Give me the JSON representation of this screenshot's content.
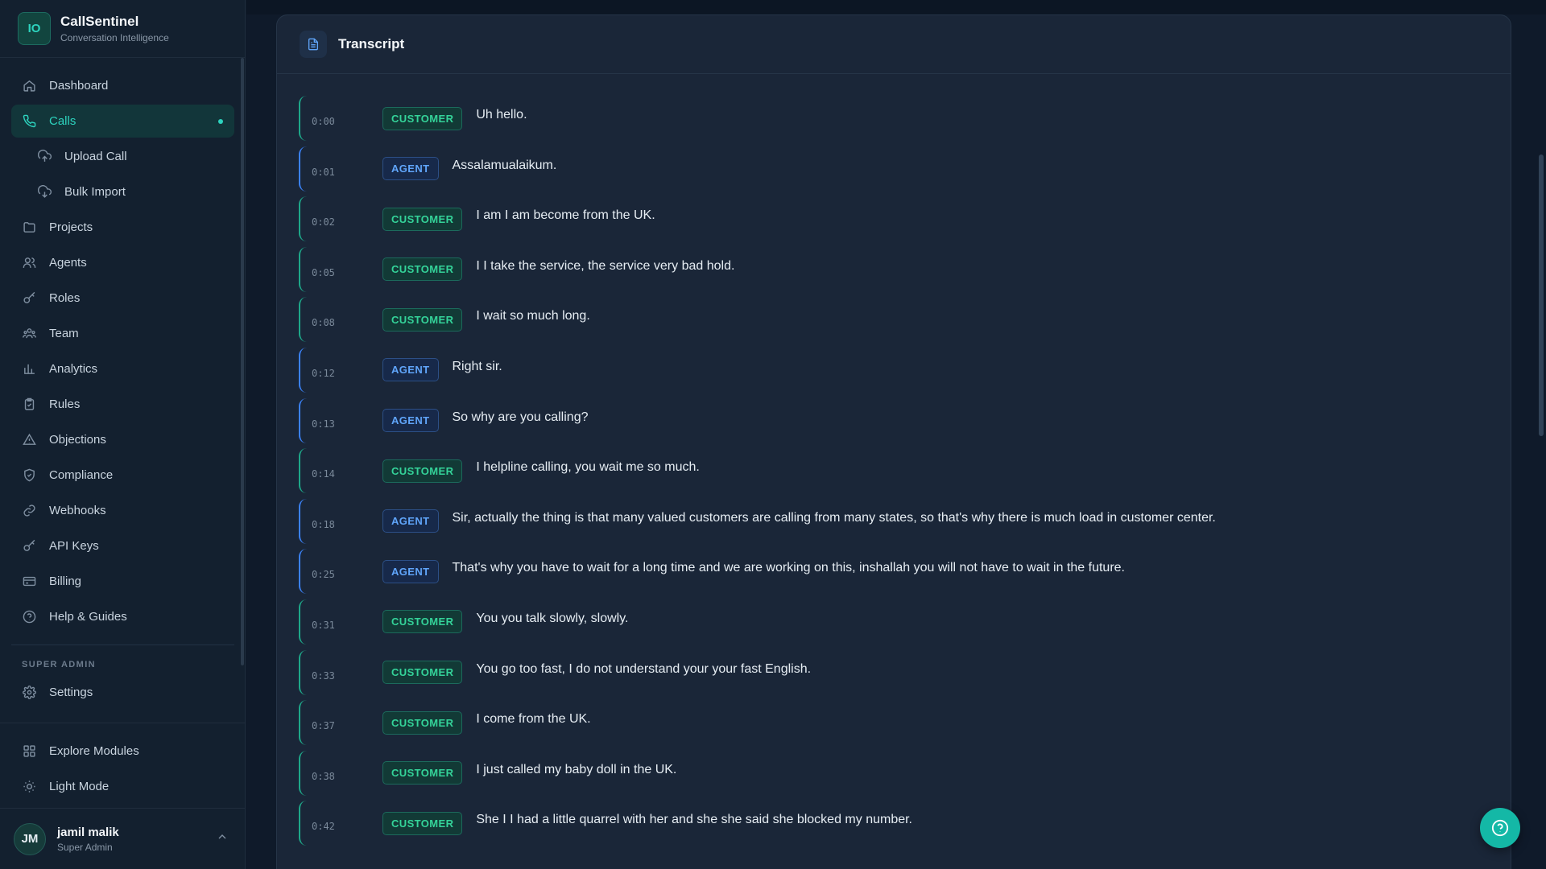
{
  "brand": {
    "logo_initials": "IO",
    "name": "CallSentinel",
    "subtitle": "Conversation Intelligence"
  },
  "nav": {
    "items": [
      {
        "label": "Dashboard",
        "icon": "home-icon",
        "active": false
      },
      {
        "label": "Calls",
        "icon": "phone-icon",
        "active": true
      },
      {
        "label": "Upload Call",
        "icon": "cloud-upload-icon",
        "sub": true
      },
      {
        "label": "Bulk Import",
        "icon": "cloud-download-icon",
        "sub": true
      },
      {
        "label": "Projects",
        "icon": "folder-icon"
      },
      {
        "label": "Agents",
        "icon": "users-icon"
      },
      {
        "label": "Roles",
        "icon": "key-icon"
      },
      {
        "label": "Team",
        "icon": "team-icon"
      },
      {
        "label": "Analytics",
        "icon": "bar-chart-icon"
      },
      {
        "label": "Rules",
        "icon": "clipboard-check-icon"
      },
      {
        "label": "Objections",
        "icon": "warning-triangle-icon"
      },
      {
        "label": "Compliance",
        "icon": "shield-check-icon"
      },
      {
        "label": "Webhooks",
        "icon": "link-icon"
      },
      {
        "label": "API Keys",
        "icon": "key-icon"
      },
      {
        "label": "Billing",
        "icon": "credit-card-icon"
      },
      {
        "label": "Help & Guides",
        "icon": "help-circle-icon"
      }
    ],
    "section_label": "SUPER ADMIN",
    "settings_label": "Settings",
    "explore_label": "Explore Modules",
    "light_mode_label": "Light Mode"
  },
  "user": {
    "initials": "JM",
    "name": "jamil malik",
    "role": "Super Admin"
  },
  "transcript": {
    "title": "Transcript",
    "segments": [
      {
        "time": "0:00",
        "speaker": "CUSTOMER",
        "text": "Uh hello."
      },
      {
        "time": "0:01",
        "speaker": "AGENT",
        "text": "Assalamualaikum."
      },
      {
        "time": "0:02",
        "speaker": "CUSTOMER",
        "text": "I am I am become from the UK."
      },
      {
        "time": "0:05",
        "speaker": "CUSTOMER",
        "text": "I I take the service, the service very bad hold."
      },
      {
        "time": "0:08",
        "speaker": "CUSTOMER",
        "text": "I wait so much long."
      },
      {
        "time": "0:12",
        "speaker": "AGENT",
        "text": "Right sir."
      },
      {
        "time": "0:13",
        "speaker": "AGENT",
        "text": "So why are you calling?"
      },
      {
        "time": "0:14",
        "speaker": "CUSTOMER",
        "text": "I helpline calling, you wait me so much."
      },
      {
        "time": "0:18",
        "speaker": "AGENT",
        "text": "Sir, actually the thing is that many valued customers are calling from many states, so that's why there is much load in customer center."
      },
      {
        "time": "0:25",
        "speaker": "AGENT",
        "text": "That's why you have to wait for a long time and we are working on this, inshallah you will not have to wait in the future."
      },
      {
        "time": "0:31",
        "speaker": "CUSTOMER",
        "text": "You you talk slowly, slowly."
      },
      {
        "time": "0:33",
        "speaker": "CUSTOMER",
        "text": "You go too fast, I do not understand your your fast English."
      },
      {
        "time": "0:37",
        "speaker": "CUSTOMER",
        "text": "I come from the UK."
      },
      {
        "time": "0:38",
        "speaker": "CUSTOMER",
        "text": "I just called my baby doll in the UK."
      },
      {
        "time": "0:42",
        "speaker": "CUSTOMER",
        "text": "She I I had a little quarrel with her and she she said she blocked my number."
      }
    ]
  },
  "colors": {
    "accent": "#2dd4bf",
    "customer": "#34d399",
    "agent": "#60a5fa",
    "background": "#0f1a2a"
  }
}
